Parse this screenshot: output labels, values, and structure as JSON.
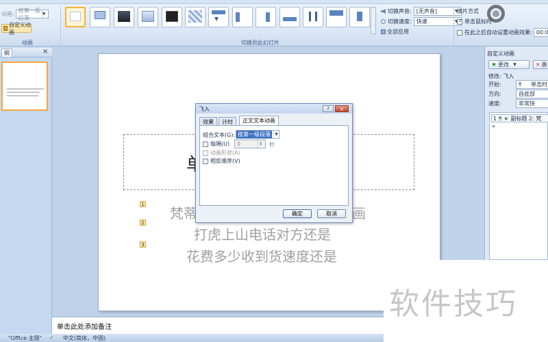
{
  "ribbon": {
    "animation_label": "动画:",
    "animation_value": "按第一级段落",
    "custom_animation_button": "自定义动画",
    "group_animation": "动画",
    "group_transition": "切换到此幻灯片",
    "sound_label": "切换声音:",
    "sound_value": "[无声音]",
    "speed_label": "切换速度:",
    "speed_value": "快速",
    "apply_all": "全部应用",
    "advance_heading": "换片方式",
    "on_click": "单击鼠标时",
    "auto_after": "在此之后自动设置动画效果:",
    "auto_time": "00:00"
  },
  "left_pane": {
    "tab_label": "纲",
    "close": "×"
  },
  "slide": {
    "title_fragment": "单",
    "lines": [
      {
        "num": "1",
        "text": "梵蒂",
        "tail": "画"
      },
      {
        "num": "2",
        "text": "打虎上山电话对方还是"
      },
      {
        "num": "3",
        "text": "花费多少收到货速度还是"
      }
    ]
  },
  "notes": {
    "placeholder": "单击此处添加备注"
  },
  "statusbar": {
    "theme": "\"Office 主题\"",
    "language": "中文(简体，中国)"
  },
  "right_pane": {
    "title": "自定义动画",
    "change_button": "更改",
    "delete_button": "删",
    "modify_label": "修改: 飞入",
    "start_label": "开始:",
    "start_value": "单击时",
    "direction_label": "方向:",
    "direction_value": "自底部",
    "speed_label": "速度:",
    "speed_value": "非常快",
    "item_num": "1",
    "item_text": "副标题 2: 梵",
    "expand": "»"
  },
  "dialog": {
    "title": "飞入",
    "help": "?",
    "close": "×",
    "tabs": [
      "效果",
      "计时",
      "正文文本动画"
    ],
    "group_text_label": "组合文本(G):",
    "group_text_value": "按第一级段落",
    "every_label": "每隔(U)",
    "every_value": "0",
    "every_unit": "秒",
    "animate_shape_label": "动画形状(A)",
    "reverse_label": "相反顺序(V)",
    "ok": "确定",
    "cancel": "取消"
  },
  "watermark": "软件技巧"
}
